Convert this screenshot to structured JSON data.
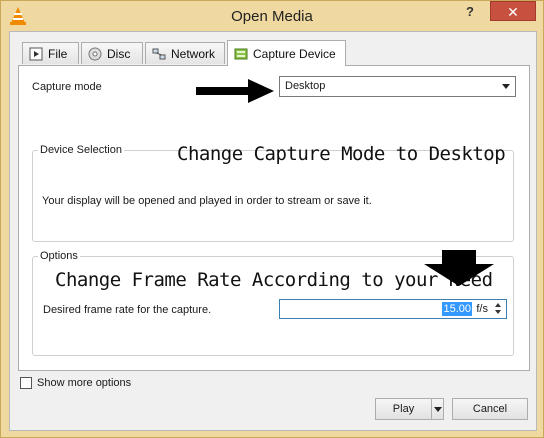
{
  "window": {
    "title": "Open Media",
    "help_label": "?",
    "close_label": "✕"
  },
  "tabs": [
    {
      "label": "File",
      "icon": "file-icon",
      "active": false
    },
    {
      "label": "Disc",
      "icon": "disc-icon",
      "active": false
    },
    {
      "label": "Network",
      "icon": "network-icon",
      "active": false
    },
    {
      "label": "Capture Device",
      "icon": "capture-device-icon",
      "active": true
    }
  ],
  "capture": {
    "mode_label": "Capture mode",
    "mode_value": "Desktop"
  },
  "device_selection": {
    "title": "Device Selection",
    "description": "Your display will be opened and played in order to stream or save it."
  },
  "options": {
    "title": "Options",
    "framerate_label": "Desired frame rate for the capture.",
    "framerate_value": "15.00",
    "framerate_unit": "f/s"
  },
  "annotations": {
    "capture_mode_hint": "Change Capture Mode to Desktop",
    "framerate_hint": "Change Frame Rate According to your Need"
  },
  "footer": {
    "show_more_label": "Show more options",
    "show_more_checked": false,
    "play_label": "Play",
    "cancel_label": "Cancel"
  },
  "colors": {
    "title_bar": "#f0d9a0",
    "close_button": "#c7503f",
    "selection": "#3399ff"
  }
}
